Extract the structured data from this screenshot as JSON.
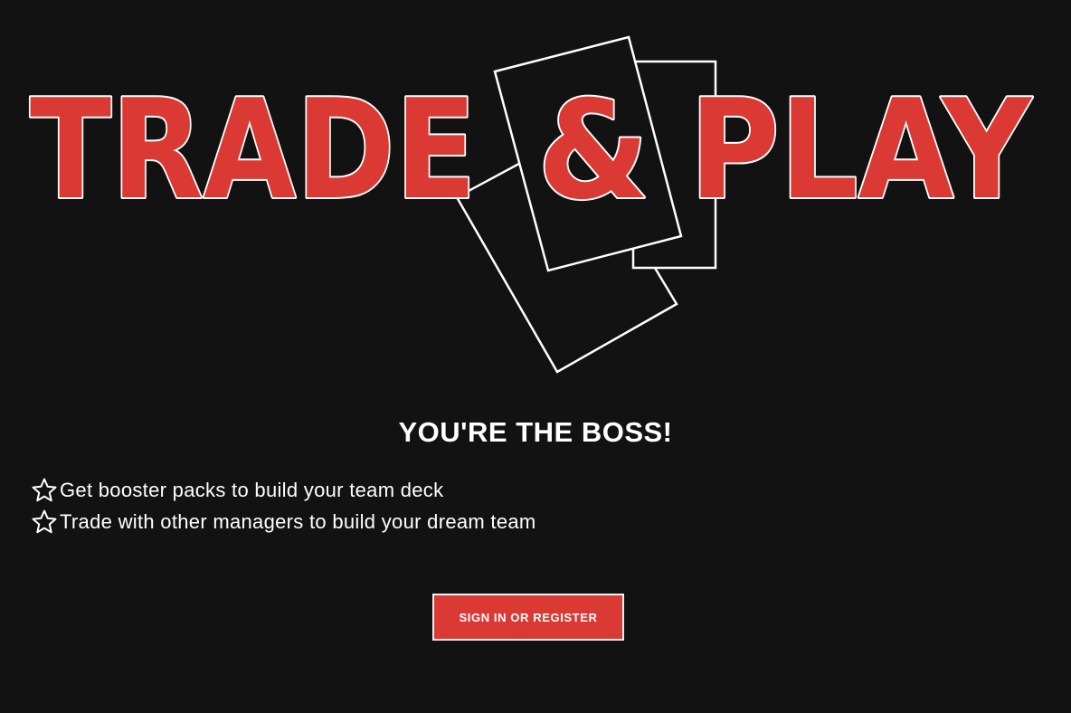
{
  "logo": {
    "word_left": "TRADE",
    "ampersand": "&",
    "word_right": "PLAY"
  },
  "headline": "YOU'RE THE BOSS!",
  "features": [
    {
      "icon": "star-outline-icon",
      "text": "Get booster packs to build your team deck"
    },
    {
      "icon": "star-outline-icon",
      "text": "Trade with other managers to build your dream team"
    }
  ],
  "cta": {
    "label": "SIGN IN OR REGISTER"
  },
  "colors": {
    "background": "#121212",
    "accent": "#db3a34",
    "text": "#ffffff",
    "outline": "#ffffff"
  }
}
